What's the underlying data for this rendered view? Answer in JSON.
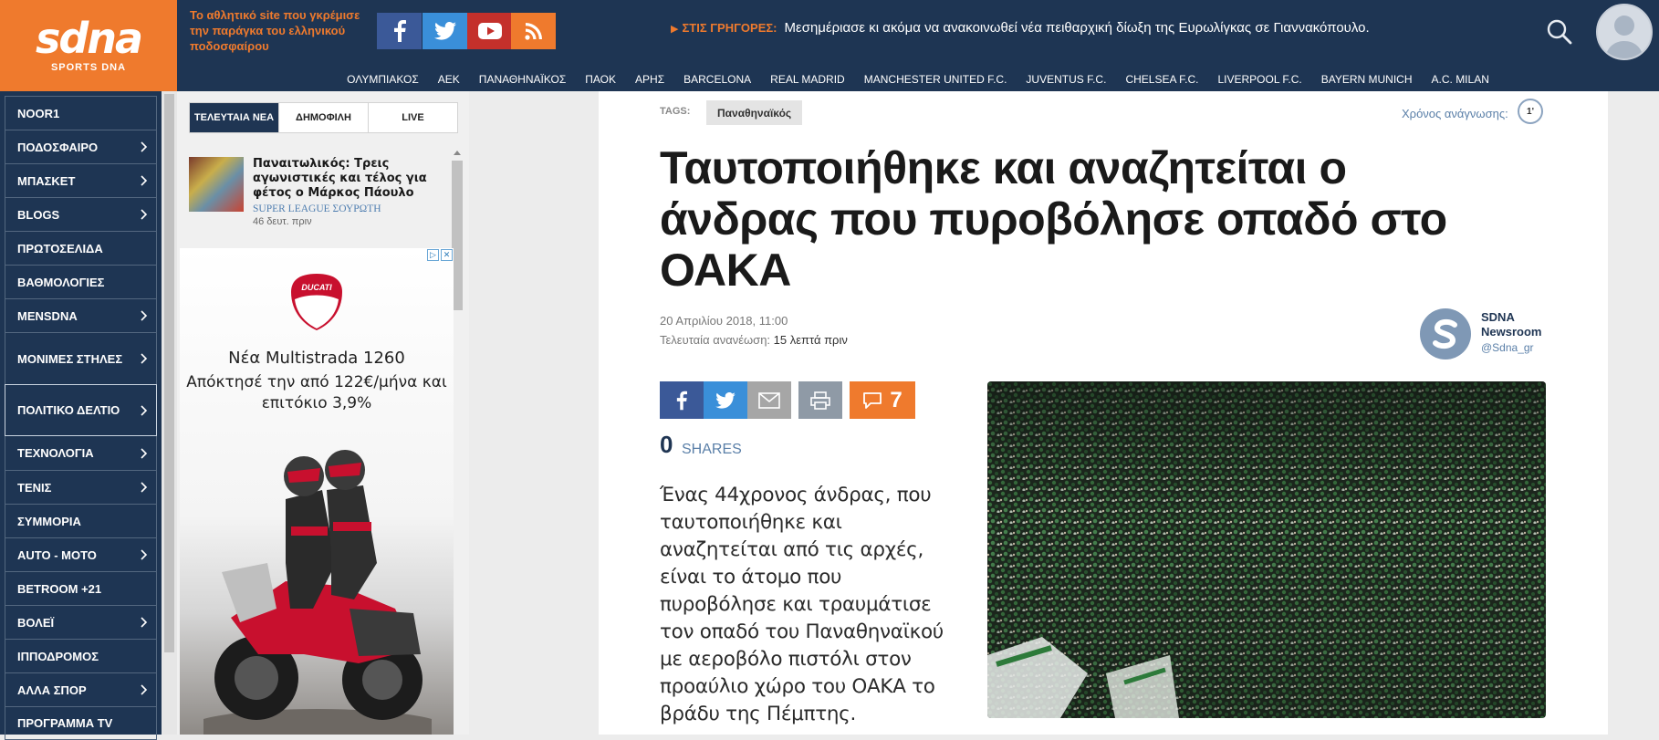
{
  "header": {
    "logo_text": "sdna",
    "logo_sub": "SPORTS DNA",
    "tagline": "Το αθλητικό site που γκρέμισε την παράγκα του ελληνικού ποδοσφαίρου",
    "breaking_label": "ΣΤΙΣ ΓΡΗΓΟΡΕΣ:",
    "breaking_text": "Μεσημέριασε κι ακόμα να ανακοινωθεί νέα πειθαρχική δίωξη της Ευρωλίγκας σε Γιαννακόπουλο.",
    "social": [
      "facebook-icon",
      "twitter-icon",
      "youtube-icon",
      "rss-icon"
    ],
    "colors": {
      "navy": "#1e3553",
      "orange": "#ef7a2d"
    }
  },
  "club_nav": [
    "ΟΛΥΜΠΙΑΚΟΣ",
    "ΑΕΚ",
    "ΠΑΝΑΘΗΝΑΪΚΟΣ",
    "ΠΑΟΚ",
    "ΑΡΗΣ",
    "BARCELONA",
    "REAL MADRID",
    "MANCHESTER UNITED F.C.",
    "JUVENTUS F.C.",
    "CHELSEA F.C.",
    "LIVERPOOL F.C.",
    "BAYERN MUNICH",
    "A.C. MILAN"
  ],
  "sidebar": {
    "items": [
      {
        "label": "NOOR1",
        "chevron": false
      },
      {
        "label": "ΠΟΔΟΣΦΑΙΡΟ",
        "chevron": true
      },
      {
        "label": "ΜΠΑΣΚΕΤ",
        "chevron": true
      },
      {
        "label": "BLOGS",
        "chevron": true
      },
      {
        "label": "ΠΡΩΤΟΣΕΛΙΔΑ",
        "chevron": false
      },
      {
        "label": "ΒΑΘΜΟΛΟΓΙΕΣ",
        "chevron": false
      },
      {
        "label": "MENSDNA",
        "chevron": true
      },
      {
        "label": "ΜΟΝΙΜΕΣ ΣΤΗΛΕΣ",
        "chevron": true
      },
      {
        "label": "ΠΟΛΙΤΙΚΟ ΔΕΛΤΙΟ",
        "chevron": true
      },
      {
        "label": "ΤΕΧΝΟΛΟΓΙΑ",
        "chevron": true
      },
      {
        "label": "ΤΕΝΙΣ",
        "chevron": true
      },
      {
        "label": "ΣΥΜΜΟΡΙΑ",
        "chevron": false
      },
      {
        "label": "AUTO - MOTO",
        "chevron": true
      },
      {
        "label": "BETROOM +21",
        "chevron": false
      },
      {
        "label": "ΒΟΛΕΪ",
        "chevron": true
      },
      {
        "label": "ΙΠΠΟΔΡΟΜΟΣ",
        "chevron": false
      },
      {
        "label": "ΑΛΛΑ ΣΠΟΡ",
        "chevron": true
      },
      {
        "label": "ΠΡΟΓΡΑΜΜΑ TV",
        "chevron": false
      }
    ]
  },
  "news_panel": {
    "tabs": [
      "ΤΕΛΕΥΤΑΙΑ ΝΕΑ",
      "ΔΗΜΟΦΙΛΗ",
      "LIVE"
    ],
    "active_tab": "ΤΕΛΕΥΤΑΙΑ ΝΕΑ",
    "item": {
      "title": "Παναιτωλικός: Τρεις αγωνιστικές και τέλος για φέτος ο Μάρκος Πάουλο",
      "category": "SUPER LEAGUE ΣΟΥΡΩΤΗ",
      "time": "46 δευτ. πριν"
    }
  },
  "ad": {
    "brand": "DUCATI",
    "headline": "Νέα Multistrada 1260",
    "sub": "Απόκτησέ την από 122€/μήνα και επιτόκιο 3,9%"
  },
  "article": {
    "tags_label": "TAGS:",
    "tag": "Παναθηναϊκός",
    "read_time_label": "Χρόνος ανάγνωσης:",
    "read_time_value": "1'",
    "headline": "Ταυτοποιήθηκε και αναζητείται ο άνδρας που πυροβόλησε οπαδό στο ΟΑΚΑ",
    "pub_date": "20 Απριλίου 2018, 11:00",
    "updated_label": "Τελευταία ανανέωση:",
    "updated_rel": "15 λεπτά πριν",
    "author_name": "SDNA Newsroom",
    "author_handle": "@Sdna_gr",
    "comments_count": "7",
    "shares_count": "0",
    "shares_label": "SHARES",
    "body": "Ένας 44χρονος άνδρας, που ταυτοποιήθηκε και αναζητείται από τις αρχές, είναι το άτομο που πυροβόλησε και τραυμάτισε τον οπαδό του Παναθηναϊκού με αεροβόλο πιστόλι στον προαύλιο χώρο του ΟΑΚΑ το βράδυ της Πέμπτης."
  }
}
